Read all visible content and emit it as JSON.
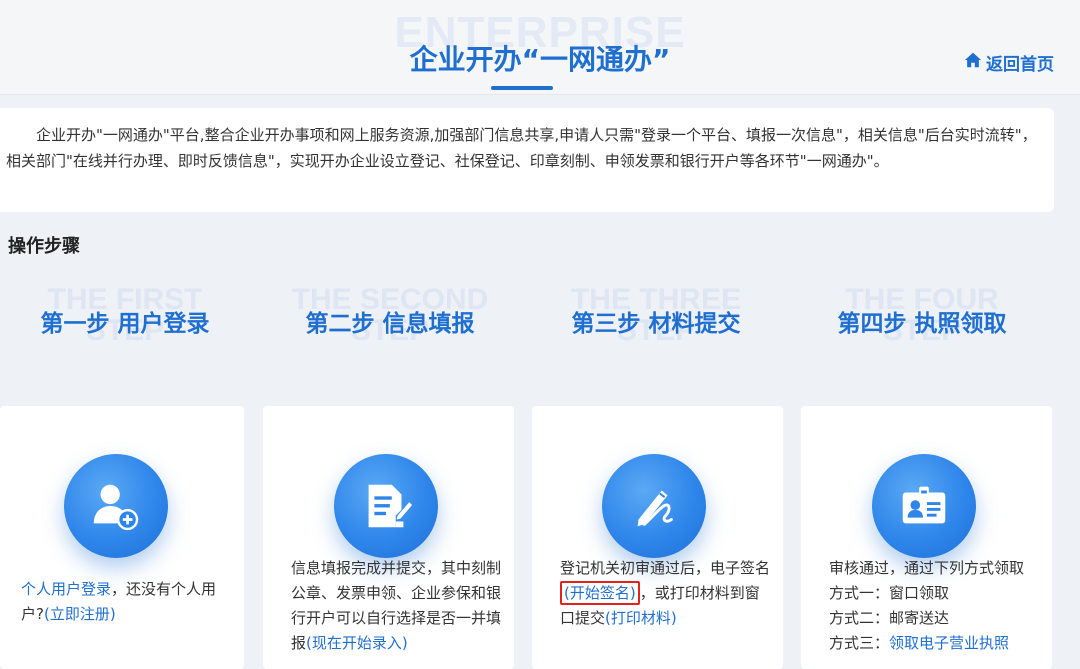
{
  "header": {
    "watermark": "ENTERPRISE",
    "title": "企业开办“一网通办”",
    "home_link": "返回首页"
  },
  "intro": {
    "text": "企业开办\"一网通办\"平台,整合企业开办事项和网上服务资源,加强部门信息共享,申请人只需\"登录一个平台、填报一次信息\"，相关信息\"后台实时流转\"，相关部门\"在线并行办理、即时反馈信息\"，实现开办企业设立登记、社保登记、印章刻制、申领发票和银行开户等各环节\"一网通办\"。"
  },
  "steps_title": "操作步骤",
  "steps": [
    {
      "watermark": "THE FIRST STEP",
      "title": "第一步 用户登录"
    },
    {
      "watermark": "THE SECOND STEP",
      "title": "第二步 信息填报"
    },
    {
      "watermark": "THE THREE STEP",
      "title": "第三步 材料提交"
    },
    {
      "watermark": "THE FOUR STEP",
      "title": "第四步 执照领取"
    }
  ],
  "cards": {
    "login": {
      "icon": "user-add-icon",
      "link": "个人用户登录",
      "text": "，还没有个人用户?",
      "register_link": "(立即注册)"
    },
    "fill": {
      "icon": "document-edit-icon",
      "text": "信息填报完成并提交，其中刻制公章、发票申领、企业参保和银行开户可以自行选择是否一并填报",
      "start_link": "(现在开始录入)"
    },
    "submit": {
      "icon": "pen-sign-icon",
      "text_a": "登记机关初审通过后，电子签名",
      "sign_link": "(开始签名)",
      "text_b": "，或打印材料到窗口提交",
      "print_link": "(打印材料)"
    },
    "license": {
      "icon": "id-card-icon",
      "line1": "审核通过，通过下列方式领取",
      "line2": "方式一：窗口领取",
      "line3": "方式二：邮寄送达",
      "line4_prefix": "方式三：",
      "line4_link": "领取电子营业执照"
    }
  },
  "colors": {
    "accent": "#1f6fd1",
    "highlight_border": "#e2231a"
  }
}
